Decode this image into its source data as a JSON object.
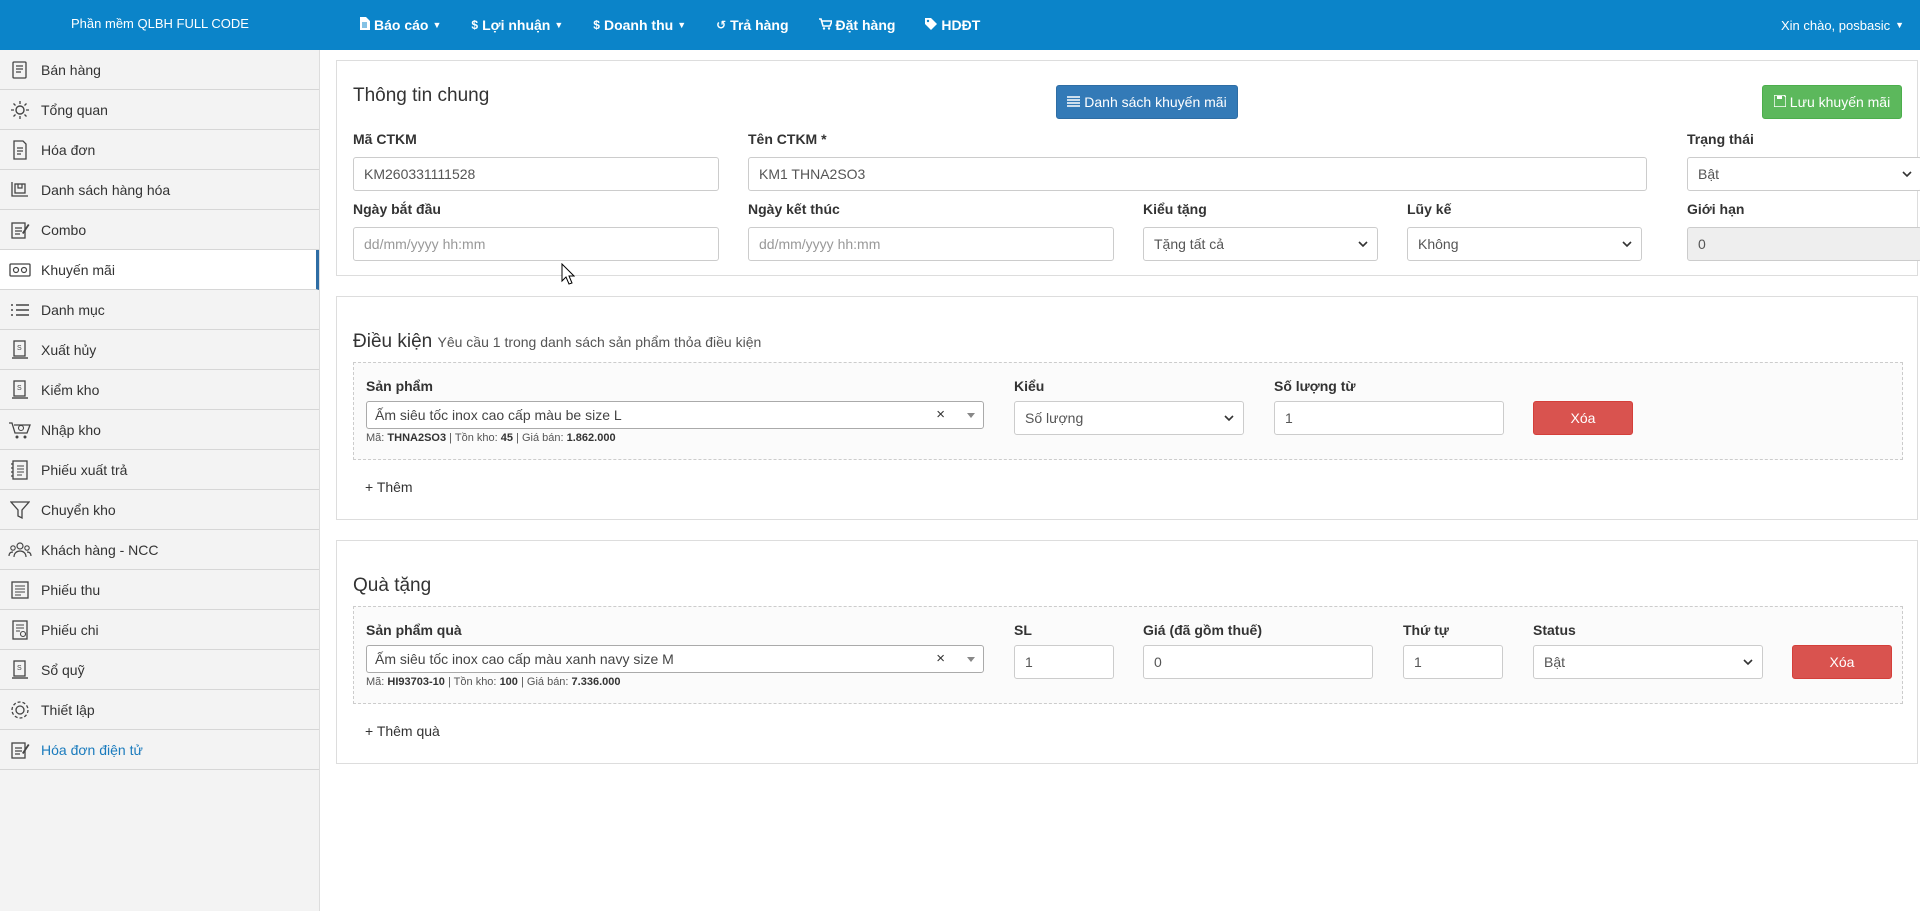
{
  "app": {
    "brand": "Phần mềm QLBH FULL CODE"
  },
  "nav": [
    {
      "label": "Báo cáo",
      "icon": "file-icon",
      "glyph": "▤",
      "dropdown": true
    },
    {
      "label": "Lợi nhuận",
      "icon": "dollar-icon",
      "glyph": "$",
      "dropdown": true
    },
    {
      "label": "Doanh thu",
      "icon": "dollar-icon",
      "glyph": "$",
      "dropdown": true
    },
    {
      "label": "Trả hàng",
      "icon": "undo-icon",
      "glyph": "↺",
      "dropdown": false
    },
    {
      "label": "Đặt hàng",
      "icon": "cart-icon",
      "glyph": "🛒",
      "dropdown": false
    },
    {
      "label": "HDĐT",
      "icon": "tag-icon",
      "glyph": "◆",
      "dropdown": false
    }
  ],
  "user": {
    "greeting": "Xin chào, posbasic"
  },
  "sidebar": {
    "items": [
      {
        "label": "Bán hàng",
        "icon": "sales-icon"
      },
      {
        "label": "Tổng quan",
        "icon": "overview-icon"
      },
      {
        "label": "Hóa đơn",
        "icon": "invoice-icon"
      },
      {
        "label": "Danh sách hàng hóa",
        "icon": "product-list-icon"
      },
      {
        "label": "Combo",
        "icon": "combo-icon"
      },
      {
        "label": "Khuyến mãi",
        "icon": "promotion-icon",
        "active": true
      },
      {
        "label": "Danh mục",
        "icon": "list-icon"
      },
      {
        "label": "Xuất hủy",
        "icon": "dispose-icon"
      },
      {
        "label": "Kiểm kho",
        "icon": "stock-check-icon"
      },
      {
        "label": "Nhập kho",
        "icon": "import-icon"
      },
      {
        "label": "Phiếu xuất trả",
        "icon": "return-slip-icon"
      },
      {
        "label": "Chuyển kho",
        "icon": "transfer-icon"
      },
      {
        "label": "Khách hàng - NCC",
        "icon": "customers-icon"
      },
      {
        "label": "Phiếu thu",
        "icon": "receipt-icon"
      },
      {
        "label": "Phiếu chi",
        "icon": "payment-icon"
      },
      {
        "label": "Sổ quỹ",
        "icon": "cashbook-icon"
      },
      {
        "label": "Thiết lập",
        "icon": "settings-icon"
      },
      {
        "label": "Hóa đơn điện tử",
        "icon": "e-invoice-icon",
        "link": true
      }
    ]
  },
  "general": {
    "title": "Thông tin chung",
    "list_button": "Danh sách khuyến mãi",
    "save_button": "Lưu khuyến mãi",
    "code_label": "Mã CTKM",
    "code_value": "KM260331111528",
    "name_label": "Tên CTKM *",
    "name_value": "KM1 THNA2SO3",
    "status_label": "Trạng thái",
    "status_value": "Bật",
    "start_label": "Ngày bắt đầu",
    "start_placeholder": "dd/mm/yyyy hh:mm",
    "end_label": "Ngày kết thúc",
    "end_placeholder": "dd/mm/yyyy hh:mm",
    "gift_type_label": "Kiểu tặng",
    "gift_type_value": "Tặng tất cả",
    "cumulative_label": "Lũy kế",
    "cumulative_value": "Không",
    "limit_label": "Giới hạn",
    "limit_value": "0"
  },
  "condition": {
    "title": "Điều kiện",
    "subtitle": "Yêu cầu 1 trong danh sách sản phẩm thỏa điều kiện",
    "product_label": "Sản phẩm",
    "product_value": "Ấm siêu tốc inox cao cấp màu be size L",
    "meta_code_label": "Mã:",
    "meta_code": "THNA2SO3",
    "meta_stock_label": "| Tồn kho:",
    "meta_stock": "45",
    "meta_price_label": "| Giá bán:",
    "meta_price": "1.862.000",
    "type_label": "Kiểu",
    "type_value": "Số lượng",
    "qty_label": "Số lượng từ",
    "qty_value": "1",
    "delete_button": "Xóa",
    "add_link": "+ Thêm"
  },
  "gift": {
    "title": "Quà tặng",
    "product_label": "Sản phẩm quà",
    "product_value": "Ấm siêu tốc inox cao cấp màu xanh navy size M",
    "meta_code_label": "Mã:",
    "meta_code": "HI93703-10",
    "meta_stock_label": "| Tồn kho:",
    "meta_stock": "100",
    "meta_price_label": "| Giá bán:",
    "meta_price": "7.336.000",
    "sl_label": "SL",
    "sl_value": "1",
    "price_label": "Giá (đã gồm thuế)",
    "price_value": "0",
    "order_label": "Thứ tự",
    "order_value": "1",
    "status_label": "Status",
    "status_value": "Bật",
    "delete_button": "Xóa",
    "add_link": "+ Thêm quà"
  }
}
